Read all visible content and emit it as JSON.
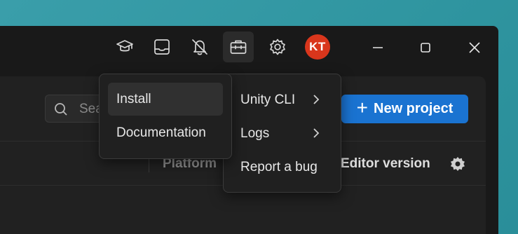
{
  "titlebar": {
    "avatar_initials": "KT",
    "icons": [
      "learn-icon",
      "inbox-icon",
      "notifications-off-icon",
      "toolbox-icon",
      "settings-icon"
    ]
  },
  "window_controls": [
    "minimize",
    "maximize",
    "close"
  ],
  "main": {
    "search_placeholder": "Search",
    "new_project_label": "New project",
    "columns": {
      "platform": "Platform",
      "editor_version": "Editor version"
    }
  },
  "menu_left": {
    "items": [
      {
        "label": "Install"
      },
      {
        "label": "Documentation"
      }
    ]
  },
  "menu_right": {
    "items": [
      {
        "label": "Unity CLI"
      },
      {
        "label": "Logs"
      },
      {
        "label": "Report a bug"
      }
    ]
  },
  "colors": {
    "accent": "#1a73d1",
    "avatar": "#d9361c",
    "window_bg": "#191919"
  }
}
